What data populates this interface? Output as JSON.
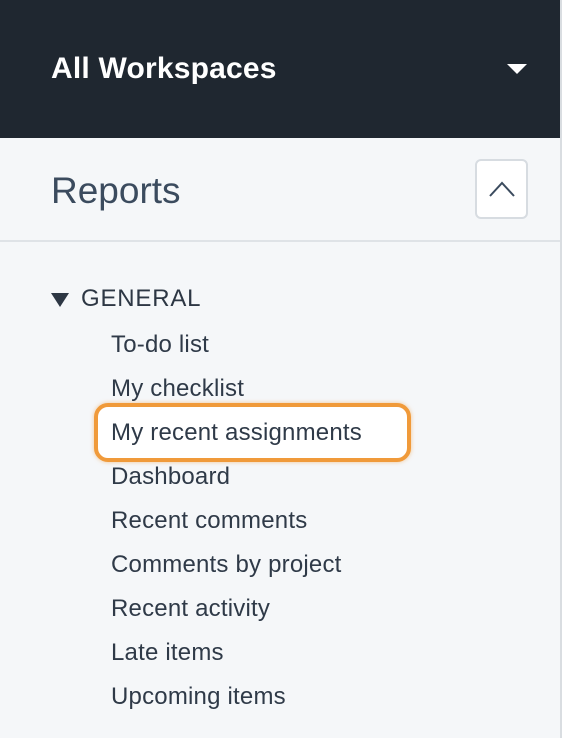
{
  "workspace": {
    "title": "All Workspaces"
  },
  "reports": {
    "title": "Reports"
  },
  "section": {
    "title": "GENERAL",
    "items": [
      {
        "label": "To-do list"
      },
      {
        "label": "My checklist"
      },
      {
        "label": "My recent assignments",
        "highlighted": true
      },
      {
        "label": "Dashboard"
      },
      {
        "label": "Recent comments"
      },
      {
        "label": "Comments by project"
      },
      {
        "label": "Recent activity"
      },
      {
        "label": "Late items"
      },
      {
        "label": "Upcoming items"
      }
    ]
  },
  "colors": {
    "header_bg": "#1f2730",
    "panel_bg": "#f5f7f9",
    "highlight": "#f09a3a",
    "text": "#2f3a48"
  },
  "icons": {
    "workspace_dropdown": "caret-down-icon",
    "collapse": "chevron-up-icon",
    "section_toggle": "triangle-down-icon"
  }
}
